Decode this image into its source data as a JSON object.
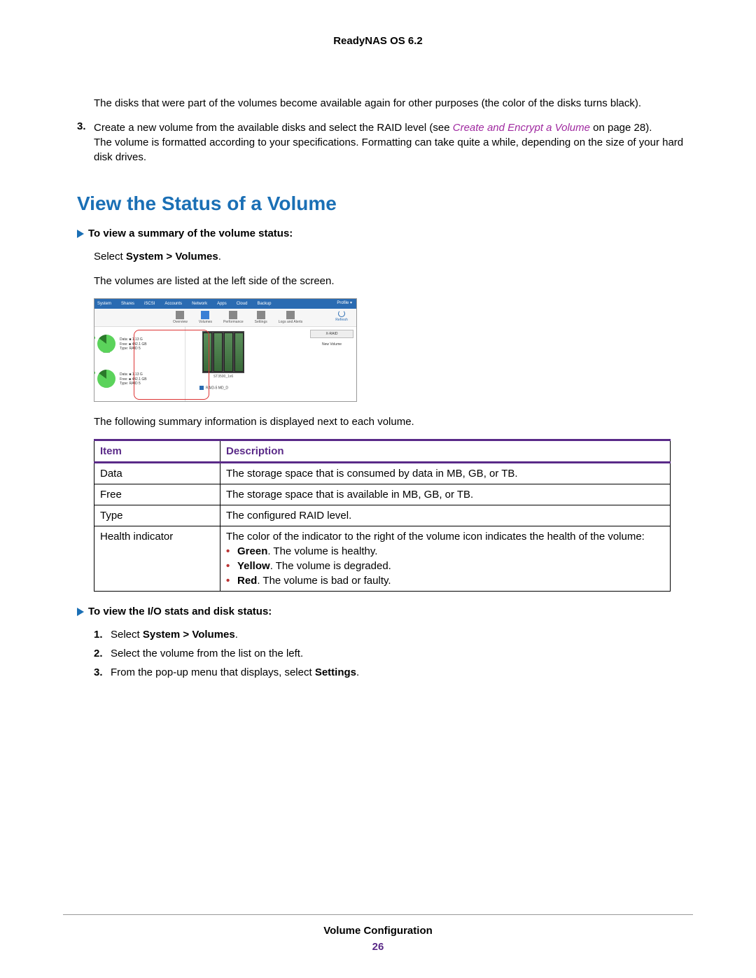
{
  "header": {
    "product": "ReadyNAS OS 6.2"
  },
  "intro": {
    "p1": "The disks that were part of the volumes become available again for other purposes (the color of the disks turns black).",
    "step3_num": "3.",
    "step3_a": "Create a new volume from the available disks and select the RAID level (see ",
    "step3_link": "Create and Encrypt a Volume",
    "step3_b": " on page 28).",
    "step3_c": "The volume is formatted according to your specifications. Formatting can take quite a while, depending on the size of your hard disk drives."
  },
  "section": {
    "heading": "View the Status of a Volume"
  },
  "proc1": {
    "title": "To view a summary of the volume status:",
    "step_a": "Select ",
    "step_bold": "System > Volumes",
    "step_c": ".",
    "note": "The volumes are listed at the left side of the screen."
  },
  "fig": {
    "topnav": [
      "System",
      "Shares",
      "iSCSI",
      "Accounts",
      "Network",
      "Apps",
      "Cloud",
      "Backup"
    ],
    "profile": "Profile ▾",
    "subnav": [
      "Overview",
      "Volumes",
      "Performance",
      "Settings",
      "Logs and Alerts"
    ],
    "refresh": "Refresh",
    "vol1_data": "Data: ■ 1.13 G",
    "vol1_free": "Free: ■ 442.1 GB",
    "vol1_type": "Type: RAID 5",
    "vol1_name": "data",
    "vol2_data": "Data: ■ 1.13 G",
    "vol2_free": "Free: ■ 442.1 GB",
    "vol2_type": "Type: RAID 5",
    "vol2_name": "vol",
    "drive_model": "ST3500_1x6",
    "raid_label": "RAID-5 MD_D",
    "xraid": "X-RAID",
    "newvol": "New Volume"
  },
  "after_fig": "The following summary information is displayed next to each volume.",
  "table": {
    "h1": "Item",
    "h2": "Description",
    "rows": [
      {
        "item": "Data",
        "desc": "The storage space that is consumed by data in MB, GB, or TB."
      },
      {
        "item": "Free",
        "desc": "The storage space that is available in MB, GB, or TB."
      },
      {
        "item": "Type",
        "desc": "The configured RAID level."
      }
    ],
    "health_item": "Health indicator",
    "health_intro": "The color of the indicator to the right of the volume icon indicates the health of the volume:",
    "health_green_b": "Green",
    "health_green_t": ". The volume is healthy.",
    "health_yellow_b": "Yellow",
    "health_yellow_t": ". The volume is degraded.",
    "health_red_b": "Red",
    "health_red_t": ". The volume is bad or faulty."
  },
  "proc2": {
    "title": "To view the I/O stats and disk status:",
    "s1_a": "Select ",
    "s1_b": "System > Volumes",
    "s1_c": ".",
    "s2": "Select the volume from the list on the left.",
    "s3_a": "From the pop-up menu that displays, select ",
    "s3_b": "Settings",
    "s3_c": "."
  },
  "footer": {
    "section": "Volume Configuration",
    "page": "26"
  }
}
